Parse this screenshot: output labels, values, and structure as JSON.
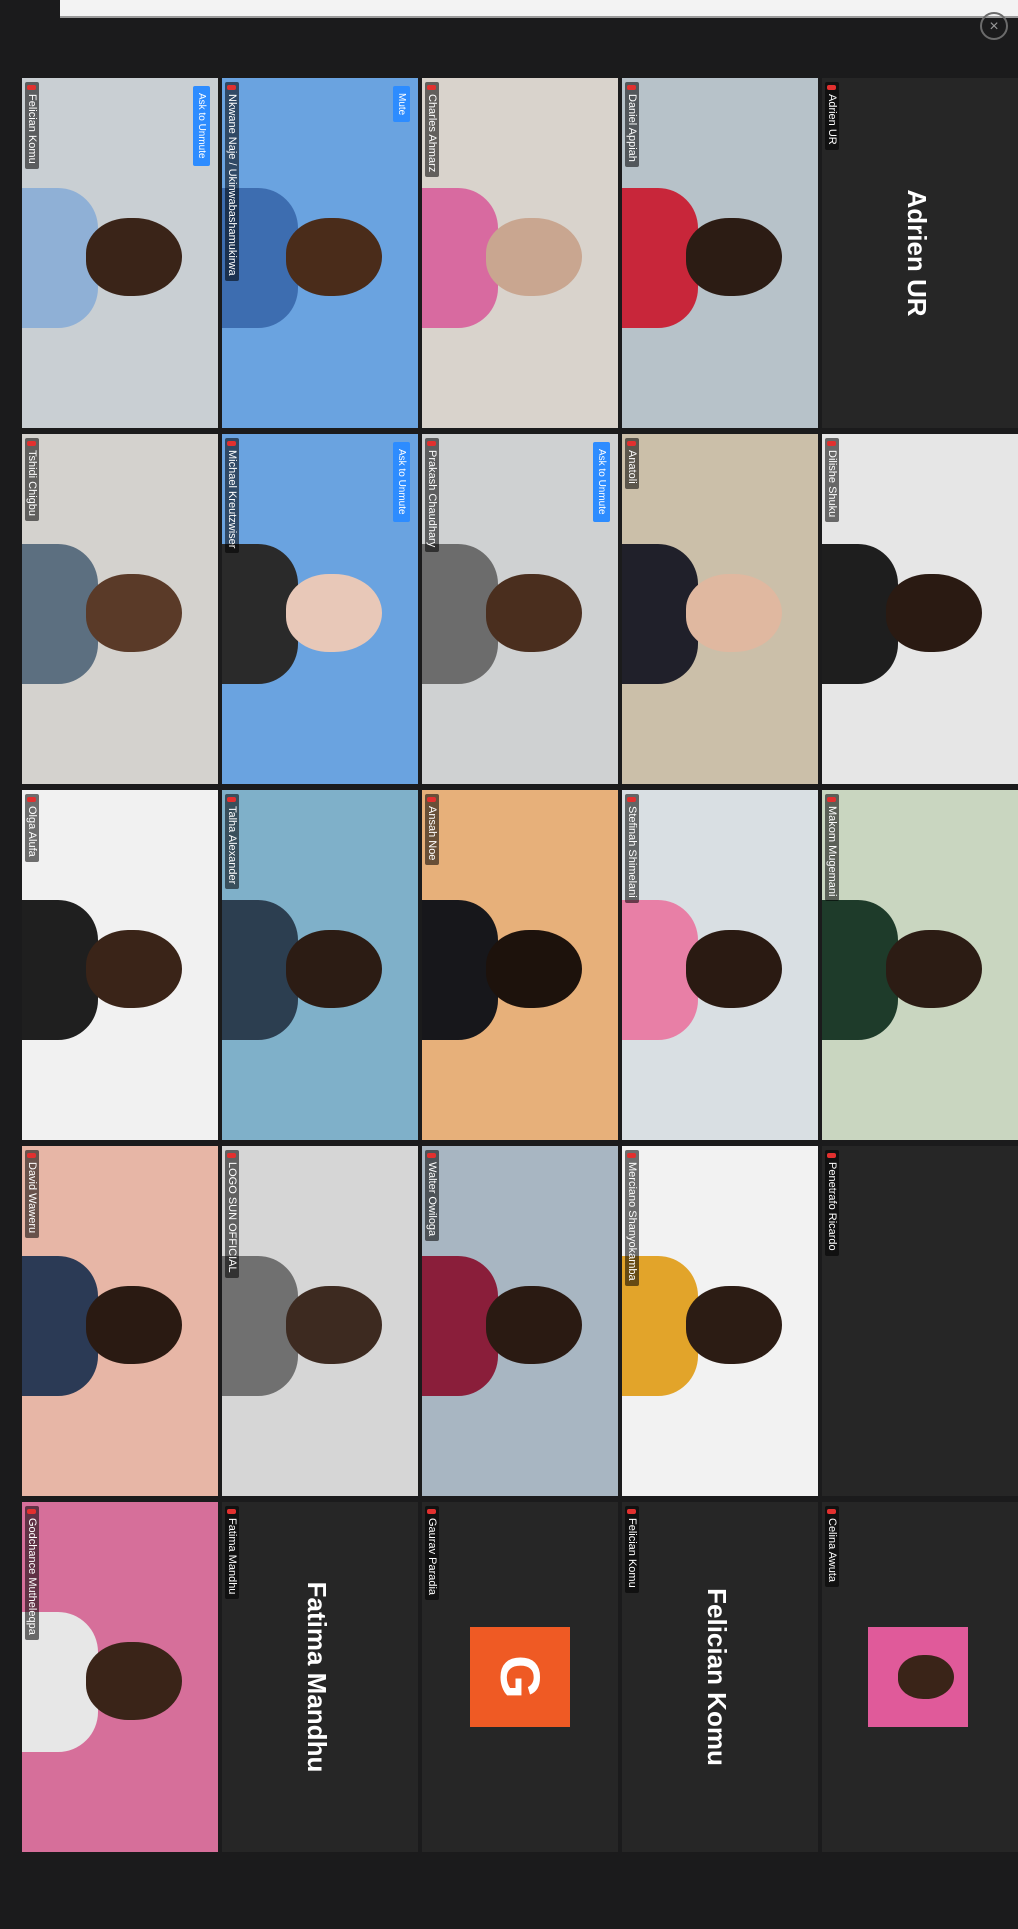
{
  "window": {
    "close_icon": "×"
  },
  "tiles": [
    {
      "id": "r0c0",
      "name": "Felician Komu",
      "button": "Ask to Unmute",
      "kind": "video",
      "bg": "#c9cfd3",
      "skin": "#3a2418",
      "shirt": "#8fb0d6"
    },
    {
      "id": "r0c1",
      "name": "Nkwane Naje / Ukinwabashamukirwa",
      "button": "Mute",
      "kind": "video",
      "bg": "#6aa3e0",
      "skin": "#4a2c1a",
      "shirt": "#3d6db0"
    },
    {
      "id": "r0c2",
      "name": "Charles Ahmarz",
      "button": "",
      "kind": "video",
      "bg": "#d9d3cc",
      "skin": "#c9a690",
      "shirt": "#d86aa0"
    },
    {
      "id": "r0c3",
      "name": "Daniel Appiah",
      "button": "",
      "kind": "video",
      "bg": "#b7c2c9",
      "skin": "#2c1c14",
      "shirt": "#c8263a"
    },
    {
      "id": "r0c4",
      "name": "Adrien UR",
      "kind": "name",
      "big": "Adrien UR"
    },
    {
      "id": "r1c0",
      "name": "Tshidi Chigbu",
      "button": "",
      "kind": "video",
      "bg": "#d4d2ce",
      "skin": "#5a3a28",
      "shirt": "#5c6f80"
    },
    {
      "id": "r1c1",
      "name": "Michael Kreutzwiser",
      "button": "Ask to Unmute",
      "kind": "video",
      "bg": "#6aa3e0",
      "skin": "#e8c8b8",
      "shirt": "#2a2a2a"
    },
    {
      "id": "r1c2",
      "name": "Prakash Chaudhary",
      "button": "Ask to Unmute",
      "kind": "video",
      "bg": "#cfd1d2",
      "skin": "#4a2e1e",
      "shirt": "#6c6c6c"
    },
    {
      "id": "r1c3",
      "name": "Anatoli",
      "button": "",
      "kind": "video",
      "bg": "#cbbfa9",
      "skin": "#e0b8a0",
      "shirt": "#20202a"
    },
    {
      "id": "r1c4",
      "name": "Dilishe Shuku",
      "button": "",
      "kind": "video",
      "bg": "#e6e6e6",
      "skin": "#2a1a12",
      "shirt": "#1e1e1e"
    },
    {
      "id": "r2c0",
      "name": "Olga Alufa",
      "button": "",
      "kind": "video",
      "bg": "#f1f1f1",
      "skin": "#3a2418",
      "shirt": "#1f1f1f"
    },
    {
      "id": "r2c1",
      "name": "Talha Alexander",
      "button": "",
      "kind": "video",
      "bg": "#7fb0c9",
      "skin": "#2c1c14",
      "shirt": "#2c3e50",
      "active": true
    },
    {
      "id": "r2c2",
      "name": "Ansah Noe",
      "button": "",
      "kind": "video",
      "bg": "#e7b07a",
      "skin": "#1d120c",
      "shirt": "#17171b"
    },
    {
      "id": "r2c3",
      "name": "Stefinah Shimelani",
      "button": "",
      "kind": "video",
      "bg": "#d9dfe3",
      "skin": "#2a1a12",
      "shirt": "#e87fa6"
    },
    {
      "id": "r2c4",
      "name": "Makom Mugemani",
      "button": "",
      "kind": "video",
      "bg": "#c9d6c0",
      "skin": "#2c1c14",
      "shirt": "#1e3b2a"
    },
    {
      "id": "r3c0",
      "name": "David Waweru",
      "button": "",
      "kind": "video",
      "bg": "#e7b6a6",
      "skin": "#2a1a12",
      "shirt": "#2b3a55"
    },
    {
      "id": "r3c1",
      "name": "LOGO SUN OFFICIAL",
      "button": "",
      "kind": "video",
      "bg": "#d6d6d6",
      "skin": "#3d2a20",
      "shirt": "#707070"
    },
    {
      "id": "r3c2",
      "name": "Walter Owiloga",
      "button": "",
      "kind": "video",
      "bg": "#a8b6c2",
      "skin": "#2a1a12",
      "shirt": "#8a1e3a"
    },
    {
      "id": "r3c3",
      "name": "Merciano Shanyokamba",
      "button": "",
      "kind": "video",
      "bg": "#f2f2f2",
      "skin": "#2c1c14",
      "shirt": "#e2a42a"
    },
    {
      "id": "r3c4",
      "name": "Penetrafo Ricardo",
      "kind": "empty"
    },
    {
      "id": "r4c0",
      "name": "Godchance Mutheleqpa",
      "button": "",
      "kind": "video",
      "bg": "#d66f9a",
      "skin": "#3a2418",
      "shirt": "#e7e7e7"
    },
    {
      "id": "r4c1",
      "name": "Fatima Mandhu",
      "kind": "name",
      "big": "Fatima Mandhu"
    },
    {
      "id": "r4c2",
      "name": "Gaurav Paradia",
      "kind": "avatar",
      "letter": "G"
    },
    {
      "id": "r4c3",
      "name": "Felician Komu",
      "kind": "name",
      "big": "Felician Komu"
    },
    {
      "id": "r4c4",
      "name": "Celina Awuta",
      "kind": "thumb",
      "bg": "#e05a9a",
      "skin": "#3a2418"
    }
  ]
}
